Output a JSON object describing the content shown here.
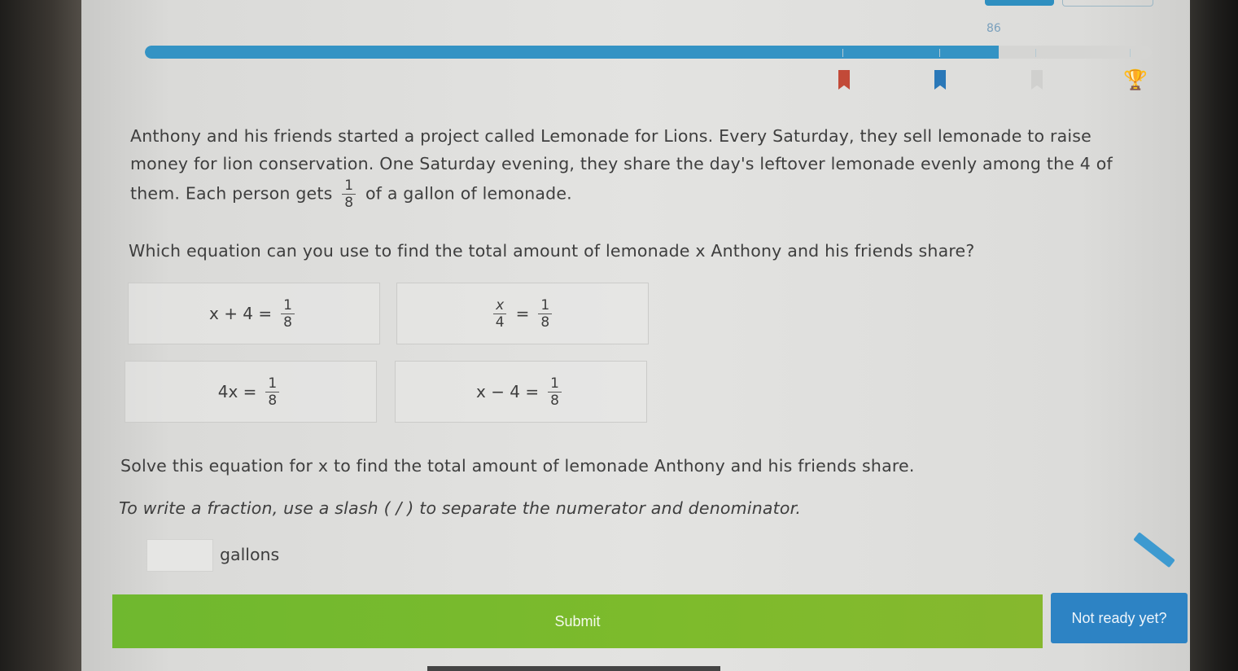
{
  "score": "86",
  "progress": {
    "fraction": 0.848
  },
  "problem": {
    "intro": "Anthony and his friends started a project called Lemonade for Lions. Every Saturday, they sell lemonade to raise money for lion conservation. One Saturday evening, they share the day's leftover lemonade evenly among the 4 of them. Each person gets",
    "intro_frac_num": "1",
    "intro_frac_den": "8",
    "intro_tail": "of a gallon of lemonade.",
    "question": "Which equation can you use to find the total amount of lemonade x Anthony and his friends share?"
  },
  "choices": [
    {
      "lhs": "x + 4 =",
      "num": "1",
      "den": "8"
    },
    {
      "lhs_num": "x",
      "lhs_den": "4",
      "op": "=",
      "num": "1",
      "den": "8"
    },
    {
      "lhs": "4x =",
      "num": "1",
      "den": "8"
    },
    {
      "lhs": "x − 4 =",
      "num": "1",
      "den": "8"
    }
  ],
  "solve_text": "Solve this equation for x to find the total amount of lemonade Anthony and his friends share.",
  "hint_text": "To write a fraction, use a slash ( / ) to separate the numerator and denominator.",
  "answer": {
    "value": "",
    "unit": "gallons"
  },
  "buttons": {
    "submit": "Submit",
    "not_ready": "Not ready yet?"
  },
  "colors": {
    "accent_blue": "#3493c4",
    "submit_green": "#7dbb2c",
    "marker_red": "#c24a38"
  },
  "icons": {
    "pencil": "pencil-icon",
    "trophy": "trophy-icon"
  }
}
